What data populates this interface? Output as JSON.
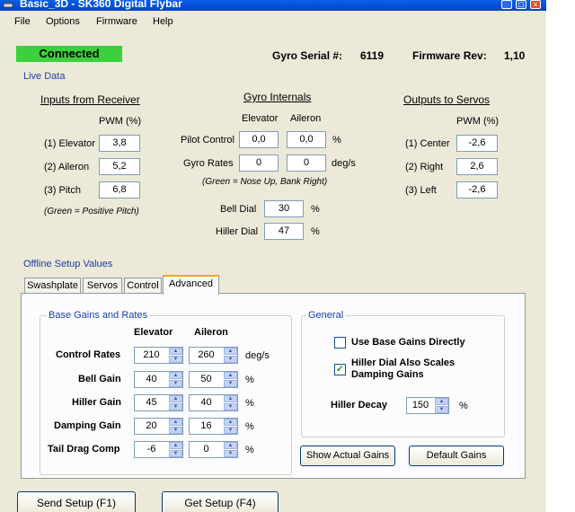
{
  "window": {
    "title": "Basic_3D - SK360 Digital Flybar"
  },
  "menu": [
    "File",
    "Options",
    "Firmware",
    "Help"
  ],
  "status": {
    "label": "Connected",
    "color": "#3cd03c"
  },
  "gyro_serial": {
    "label": "Gyro Serial #:",
    "value": "6119"
  },
  "firmware_rev": {
    "label": "Firmware Rev:",
    "value": "1,10"
  },
  "live_data": {
    "title": "Live Data",
    "inputs": {
      "heading": "Inputs from Receiver",
      "unit_header": "PWM (%)",
      "rows": [
        {
          "label": "(1) Elevator",
          "value": "3,8"
        },
        {
          "label": "(2) Aileron",
          "value": "5,2"
        },
        {
          "label": "(3) Pitch",
          "value": "6,8"
        }
      ],
      "note": "(Green = Positive Pitch)"
    },
    "gyro": {
      "heading": "Gyro Internals",
      "col_elevator": "Elevator",
      "col_aileron": "Aileron",
      "rows": [
        {
          "label": "Pilot Control",
          "elevator": "0,0",
          "aileron": "0,0",
          "unit": "%"
        },
        {
          "label": "Gyro Rates",
          "elevator": "0",
          "aileron": "0",
          "unit": "deg/s"
        }
      ],
      "note": "(Green = Nose Up, Bank Right)",
      "bell_dial": {
        "label": "Bell Dial",
        "value": "30",
        "unit": "%"
      },
      "hiller_dial": {
        "label": "Hiller Dial",
        "value": "47",
        "unit": "%"
      }
    },
    "outputs": {
      "heading": "Outputs to Servos",
      "unit_header": "PWM (%)",
      "rows": [
        {
          "label": "(1) Center",
          "value": "-2,6"
        },
        {
          "label": "(2) Right",
          "value": "2,6"
        },
        {
          "label": "(3) Left",
          "value": "-2,6"
        }
      ]
    }
  },
  "offline": {
    "title": "Offline Setup Values",
    "tabs": [
      {
        "label": "Swashplate",
        "active": false
      },
      {
        "label": "Servos",
        "active": false
      },
      {
        "label": "Control",
        "active": false
      },
      {
        "label": "Advanced",
        "active": true
      }
    ],
    "base_gains": {
      "title": "Base Gains and Rates",
      "col_elevator": "Elevator",
      "col_aileron": "Aileron",
      "rows": [
        {
          "label": "Control Rates",
          "elevator": "210",
          "aileron": "260",
          "unit": "deg/s"
        },
        {
          "label": "Bell Gain",
          "elevator": "40",
          "aileron": "50",
          "unit": "%"
        },
        {
          "label": "Hiller Gain",
          "elevator": "45",
          "aileron": "40",
          "unit": "%"
        },
        {
          "label": "Damping Gain",
          "elevator": "20",
          "aileron": "16",
          "unit": "%"
        },
        {
          "label": "Tail Drag Comp",
          "elevator": "-6",
          "aileron": "0",
          "unit": "%"
        }
      ]
    },
    "general": {
      "title": "General",
      "use_base_gains": {
        "label": "Use Base Gains Directly",
        "checked": false
      },
      "hiller_dial_scales": {
        "label_line1": "Hiller Dial Also Scales",
        "label_line2": "Damping Gains",
        "checked": true
      },
      "hiller_decay": {
        "label": "Hiller Decay",
        "value": "150",
        "unit": "%"
      }
    },
    "buttons": {
      "show_actual": "Show Actual Gains",
      "default_gains": "Default Gains"
    }
  },
  "footer": {
    "send_setup": "Send Setup (F1)",
    "get_setup": "Get Setup (F4)"
  }
}
